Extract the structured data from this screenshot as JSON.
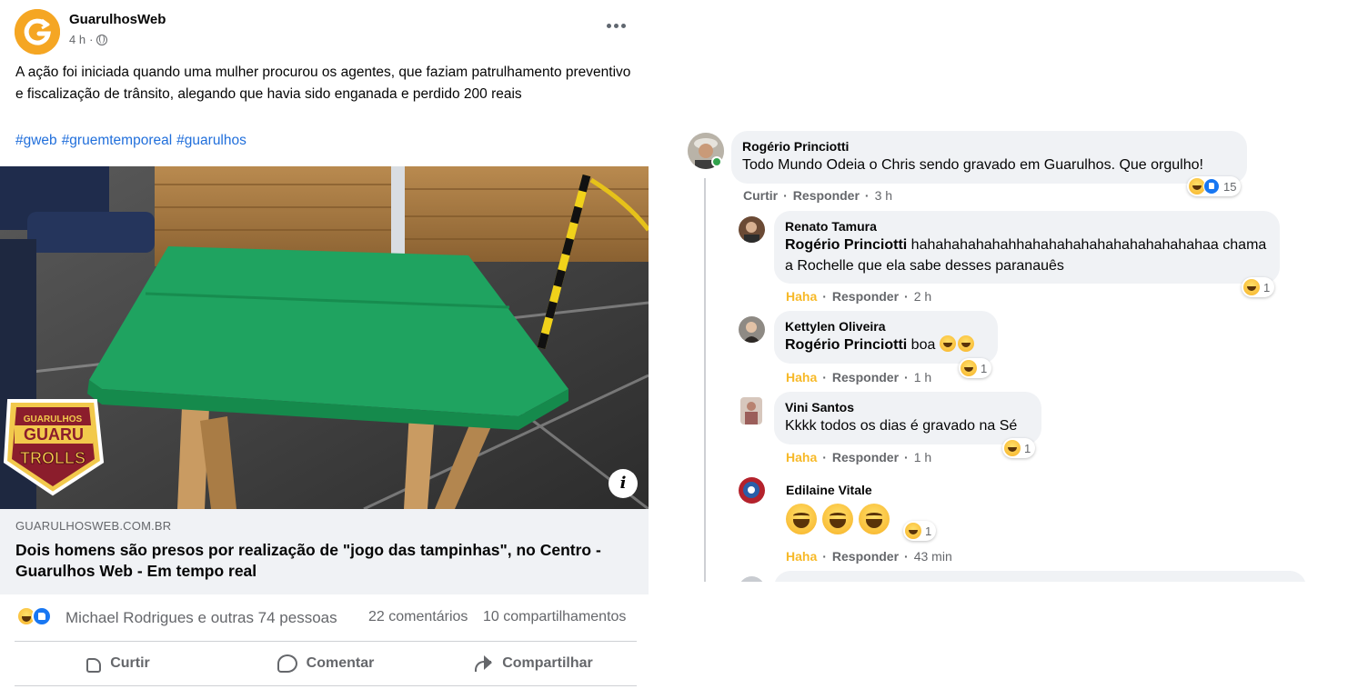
{
  "post": {
    "page_name": "GuarulhosWeb",
    "time": "4 h",
    "avatar_icon": "guarulhosweb-logo",
    "text": "A ação foi iniciada quando uma mulher procurou os agentes, que faziam patrulhamento preventivo e fiscalização de trânsito, alegando que havia sido enganada e perdido 200 reais",
    "hashtags": [
      "#gweb",
      "#gruemtemporeal",
      "#guarulhos"
    ],
    "link": {
      "domain": "GUARULHOSWEB.COM.BR",
      "title": "Dois homens são presos por realização de \"jogo das tampinhas\", no Centro - Guarulhos Web - Em tempo real",
      "badge_top": "GUARULHOS",
      "badge_mid": "GUARU",
      "badge_bottom": "TROLLS",
      "info_icon": "i"
    },
    "stats": {
      "reactions": [
        "haha",
        "like"
      ],
      "names": "Michael Rodrigues e outras 74 pessoas",
      "comments": "22 comentários",
      "shares": "10 compartilhamentos"
    },
    "actions": {
      "like": "Curtir",
      "comment": "Comentar",
      "share": "Compartilhar"
    }
  },
  "comments": [
    {
      "author": "Rogério Princiotti",
      "text": "Todo Mundo Odeia o Chris sendo gravado em Guarulhos. Que orgulho!",
      "action1": "Curtir",
      "reply": "Responder",
      "time": "3 h",
      "reaction_count": "15"
    },
    {
      "author": "Renato Tamura",
      "mention": "Rogério Princiotti",
      "text": " hahahahahahahhahahahahahahahahahahahaa chama a Rochelle que ela sabe desses paranauês",
      "action1": "Haha",
      "reply": "Responder",
      "time": "2 h",
      "reaction_count": "1"
    },
    {
      "author": "Kettylen Oliveira",
      "mention": "Rogério Princiotti",
      "text": " boa",
      "action1": "Haha",
      "reply": "Responder",
      "time": "1 h",
      "reaction_count": "1"
    },
    {
      "author": "Vini Santos",
      "text": "Kkkk todos os dias é gravado na Sé",
      "action1": "Haha",
      "reply": "Responder",
      "time": "1 h",
      "reaction_count": "1"
    },
    {
      "author": "Edilaine Vitale",
      "action1": "Haha",
      "reply": "Responder",
      "time": "43 min",
      "reaction_count": "1"
    }
  ],
  "colors": {
    "link_blue": "#216fdb",
    "haha_yellow": "#f7b928",
    "bubble_bg": "#f0f2f5",
    "muted_text": "#65676b"
  }
}
